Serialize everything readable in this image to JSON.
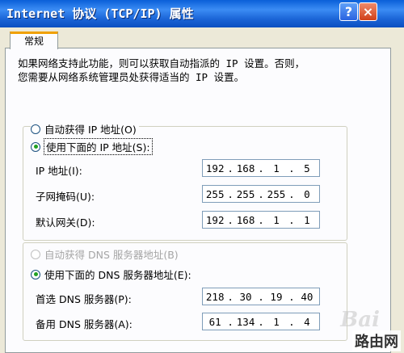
{
  "window": {
    "title": "Internet 协议 (TCP/IP) 属性"
  },
  "titlebar": {
    "help_glyph": "?",
    "close_glyph": "×"
  },
  "tabs": [
    {
      "label": "常规"
    }
  ],
  "description": {
    "line1": "如果网络支持此功能，则可以获取自动指派的 IP 设置。否则，",
    "line2": "您需要从网络系统管理员处获得适当的 IP 设置。"
  },
  "ip_group": {
    "auto_label": "自动获得 IP 地址(O)",
    "manual_label": "使用下面的 IP 地址(S):",
    "selected": "manual",
    "fields": [
      {
        "label": "IP 地址(I):",
        "octets": [
          "192",
          "168",
          "1",
          "5"
        ]
      },
      {
        "label": "子网掩码(U):",
        "octets": [
          "255",
          "255",
          "255",
          "0"
        ]
      },
      {
        "label": "默认网关(D):",
        "octets": [
          "192",
          "168",
          "1",
          "1"
        ]
      }
    ]
  },
  "dns_group": {
    "auto_label": "自动获得 DNS 服务器地址(B)",
    "manual_label": "使用下面的 DNS 服务器地址(E):",
    "selected": "manual",
    "fields": [
      {
        "label": "首选 DNS 服务器(P):",
        "octets": [
          "218",
          "30",
          "19",
          "40"
        ]
      },
      {
        "label": "备用 DNS 服务器(A):",
        "octets": [
          "61",
          "134",
          "1",
          "4"
        ]
      }
    ]
  },
  "watermark": {
    "text": "路由网",
    "logo": "Bai"
  }
}
